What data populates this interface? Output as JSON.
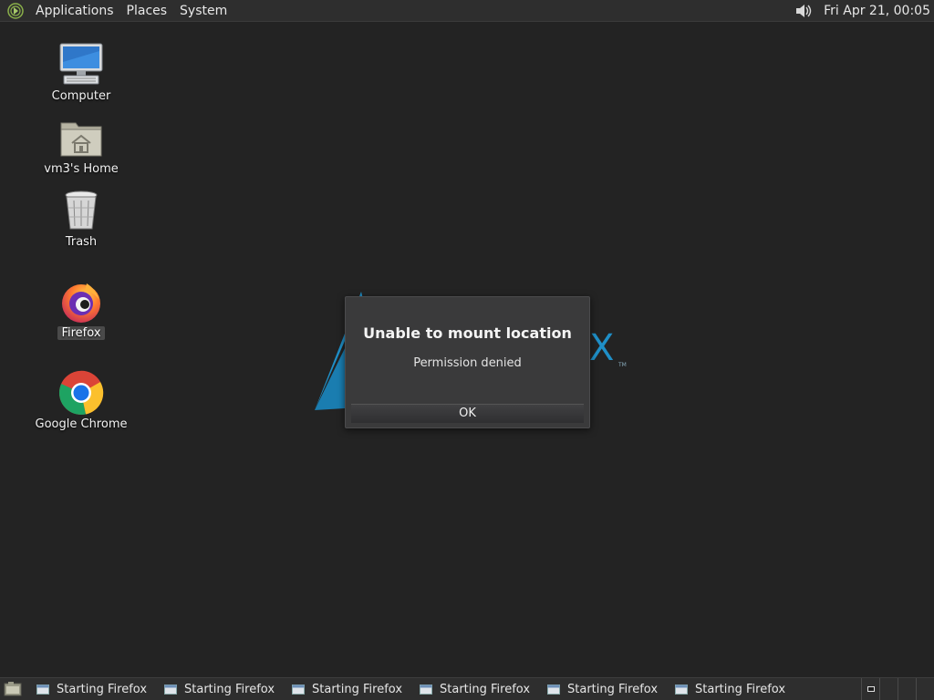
{
  "top_panel": {
    "menus": [
      "Applications",
      "Places",
      "System"
    ],
    "clock": "Fri Apr 21, 00:05",
    "icons": [
      "distro-logo-icon",
      "volume-icon"
    ]
  },
  "desktop": {
    "icons": [
      {
        "label": "Computer",
        "icon": "computer-icon"
      },
      {
        "label": "vm3's Home",
        "icon": "home-folder-icon"
      },
      {
        "label": "Trash",
        "icon": "trash-icon"
      },
      {
        "label": "Firefox",
        "icon": "firefox-icon",
        "selected": true
      },
      {
        "label": "Google Chrome",
        "icon": "chrome-icon"
      }
    ]
  },
  "dialog": {
    "title": "Unable to mount location",
    "message": "Permission denied",
    "ok_label": "OK"
  },
  "background_logo": {
    "letter": "X",
    "tm": "TM",
    "color": "#1f8fc7"
  },
  "taskbar": {
    "tasks": [
      {
        "label": "Starting Firefox"
      },
      {
        "label": "Starting Firefox"
      },
      {
        "label": "Starting Firefox"
      },
      {
        "label": "Starting Firefox"
      },
      {
        "label": "Starting Firefox"
      },
      {
        "label": "Starting Firefox"
      }
    ],
    "workspaces": 4
  },
  "colors": {
    "desktop_bg": "#232323",
    "panel_bg": "#2e2e2e",
    "dialog_bg": "#3a3a3b",
    "accent_blue": "#1f8fc7"
  }
}
